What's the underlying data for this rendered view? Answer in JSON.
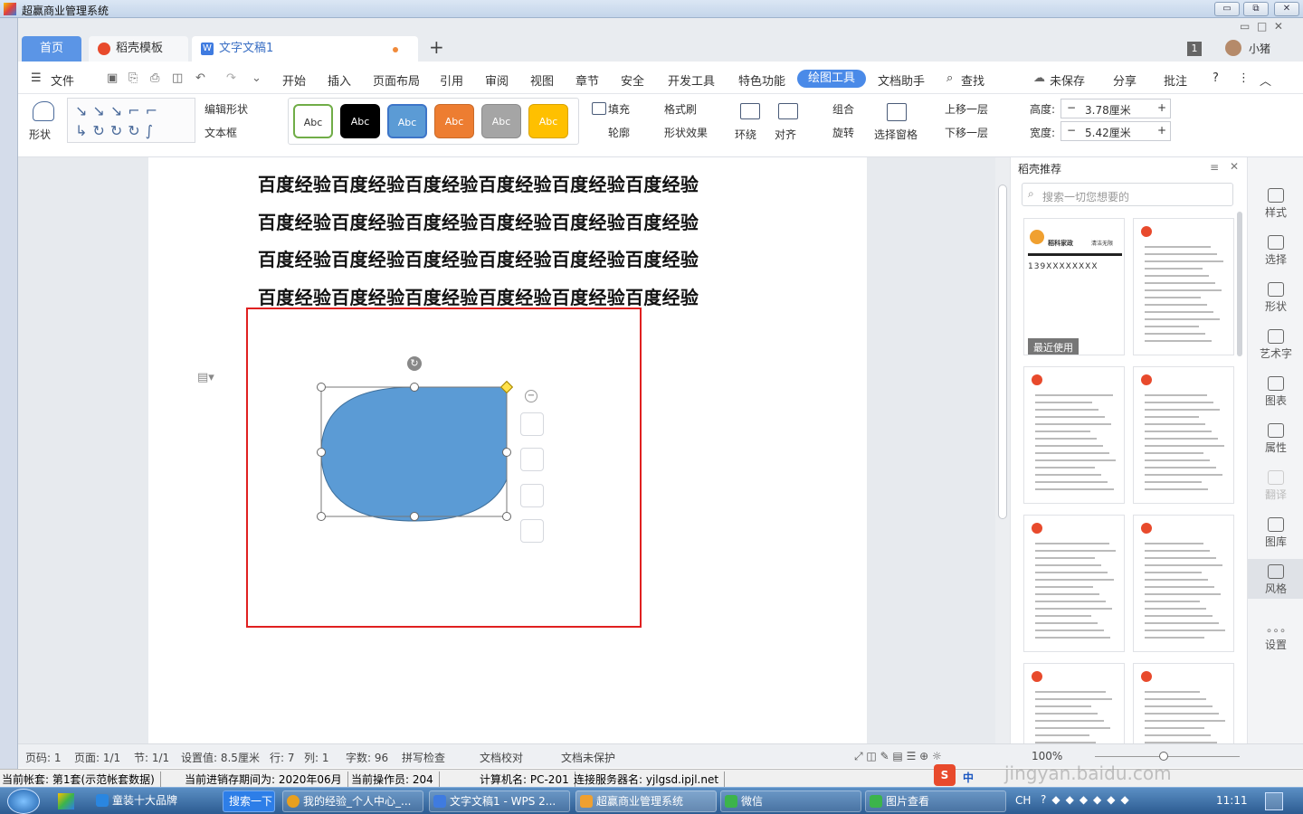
{
  "outer_window": {
    "title": "超赢商业管理系统",
    "min": "▭",
    "restore": "⧉",
    "close": "✕"
  },
  "tabs": {
    "home": "首页",
    "template": "稻壳模板",
    "document": "文字文稿1",
    "add": "+"
  },
  "top_right": {
    "badge": "1",
    "user": "小猪"
  },
  "menu": {
    "file": "文件",
    "items": [
      "开始",
      "插入",
      "页面布局",
      "引用",
      "审阅",
      "视图",
      "章节",
      "安全",
      "开发工具",
      "特色功能",
      "绘图工具",
      "文档助手"
    ],
    "search": "查找",
    "unsaved": "未保存",
    "share": "分享",
    "comment": "批注",
    "help": "?"
  },
  "ribbon": {
    "shape": "形状",
    "edit_shape": "编辑形状",
    "textbox": "文本框",
    "style_sample": "Abc",
    "fill": "填充",
    "format_brush": "格式刷",
    "outline": "轮廓",
    "shape_effect": "形状效果",
    "wrap": "环绕",
    "align": "对齐",
    "group": "组合",
    "rotate": "旋转",
    "select_pane": "选择窗格",
    "bring_forward": "上移一层",
    "send_backward": "下移一层",
    "height_label": "高度:",
    "height_value": "3.78厘米",
    "width_label": "宽度:",
    "width_value": "5.42厘米",
    "minus": "−",
    "plus": "+"
  },
  "style_colors": [
    "#ffffff",
    "#000000",
    "#5b9bd5",
    "#ed7d31",
    "#a5a5a5",
    "#ffc000"
  ],
  "document": {
    "lines": [
      "百度经验百度经验百度经验百度经验百度经验百度经验",
      "百度经验百度经验百度经验百度经验百度经验百度经验",
      "百度经验百度经验百度经验百度经验百度经验百度经验",
      "百度经验百度经验百度经验百度经验百度经验百度经验"
    ],
    "shape_fill": "#5b9bd5",
    "highlight_color": "#e02020"
  },
  "right_pane": {
    "title": "稻壳推荐",
    "search_placeholder": "搜索一切您想要的",
    "recent": "最近使用",
    "card1_brand": "稻科家政",
    "card1_phone": "139XXXXXXXX",
    "card1_tag": "清洁无限"
  },
  "right_tools": [
    "样式",
    "选择",
    "形状",
    "艺术字",
    "图表",
    "属性",
    "翻译",
    "图库",
    "风格",
    "设置"
  ],
  "status": {
    "page_code": "页码: 1",
    "pages": "页面: 1/1",
    "section": "节: 1/1",
    "setting": "设置值: 8.5厘米",
    "row": "行: 7",
    "col": "列: 1",
    "words": "字数: 96",
    "spell": "拼写检查",
    "proof": "文档校对",
    "protect": "文档未保护",
    "zoom": "100%"
  },
  "legacy": {
    "account": "当前帐套: 第1套(示范帐套数据)",
    "period": "当前进销存期间为: 2020年06月",
    "operator": "当前操作员: 204",
    "pc": "计算机名: PC-201",
    "server": "连接服务器名: yjlgsd.ipjl.net"
  },
  "taskbar": {
    "items": [
      "童装十大品牌",
      "搜索一下",
      "我的经验_个人中心_...",
      "文字文稿1 - WPS 2...",
      "超赢商业管理系统",
      "微信",
      "图片查看"
    ],
    "lang": "CH",
    "time": "11:11",
    "ime": "中"
  },
  "watermark": "jingyan.baidu.com"
}
